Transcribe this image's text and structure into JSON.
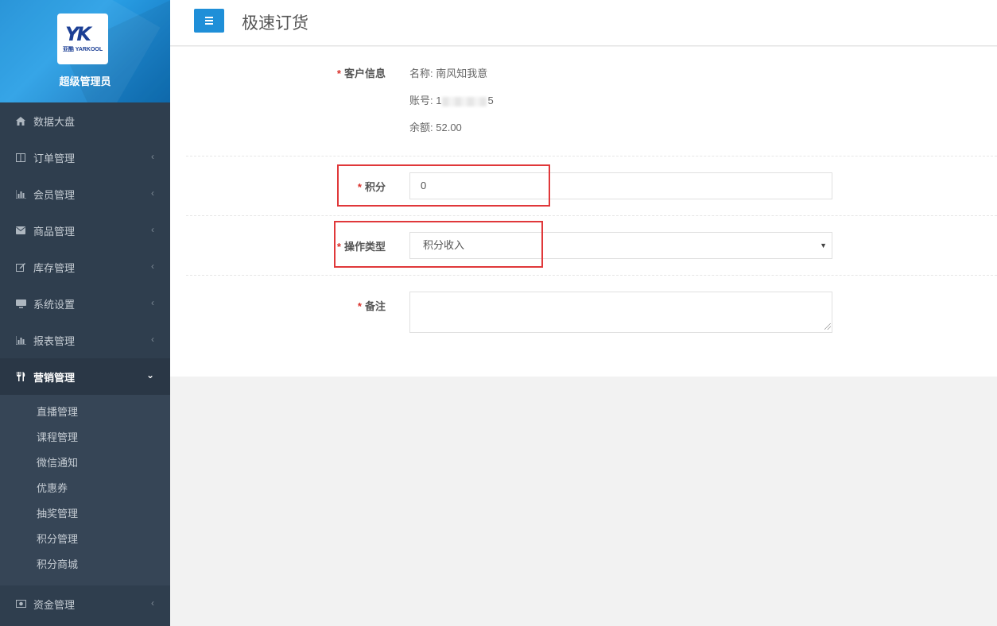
{
  "sidebar": {
    "logo": {
      "mark": "YK",
      "sub": "亚酷 YARKOOL"
    },
    "admin_name": "超级管理员",
    "items": [
      {
        "label": "数据大盘",
        "icon": "home-icon"
      },
      {
        "label": "订单管理",
        "icon": "columns-icon"
      },
      {
        "label": "会员管理",
        "icon": "bar-chart-icon"
      },
      {
        "label": "商品管理",
        "icon": "envelope-icon"
      },
      {
        "label": "库存管理",
        "icon": "edit-icon"
      },
      {
        "label": "系统设置",
        "icon": "monitor-icon"
      },
      {
        "label": "报表管理",
        "icon": "bar-chart-icon"
      },
      {
        "label": "营销管理",
        "icon": "cutlery-icon",
        "expanded": true
      },
      {
        "label": "资金管理",
        "icon": "money-icon"
      }
    ],
    "submenu": [
      "直播管理",
      "课程管理",
      "微信通知",
      "优惠券",
      "抽奖管理",
      "积分管理",
      "积分商城"
    ]
  },
  "header": {
    "title": "极速订货"
  },
  "form": {
    "required_mark": "*",
    "customer": {
      "label": "客户信息",
      "name_label": "名称:",
      "name": "南风知我意",
      "account_label": "账号:",
      "account_start": "1",
      "account_end": "5",
      "balance_label": "余额:",
      "balance": "52.00"
    },
    "points": {
      "label": "积分",
      "value": "0"
    },
    "op_type": {
      "label": "操作类型",
      "value": "积分收入"
    },
    "remark": {
      "label": "备注",
      "value": ""
    }
  },
  "colors": {
    "sidebar_bg": "#2f3e4e",
    "accent": "#1f8fd8",
    "required": "#d9302a",
    "highlight_box": "#e0383a"
  }
}
